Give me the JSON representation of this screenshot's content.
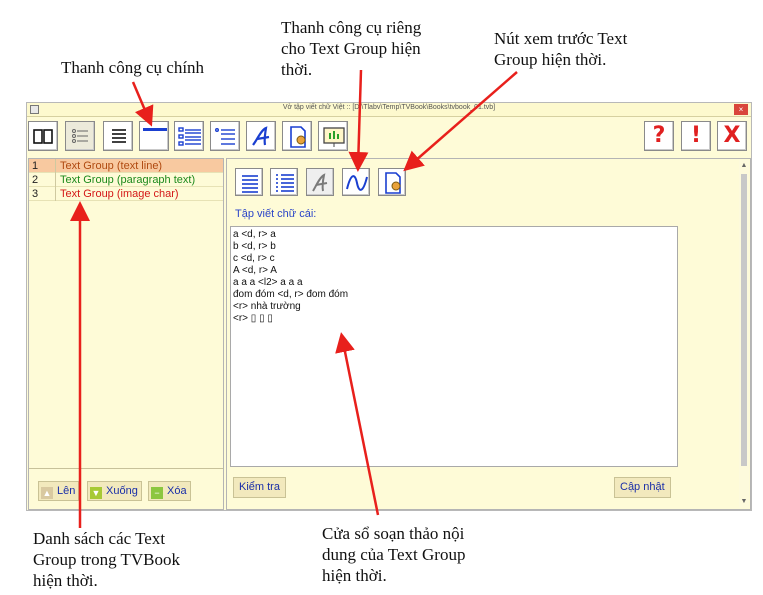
{
  "annotations": {
    "main_toolbar": "Thanh công cụ chính",
    "group_toolbar": [
      "Thanh công cụ riêng",
      "cho Text Group hiện",
      "thời."
    ],
    "preview_button": [
      "Nút xem trước Text",
      "Group hiện thời."
    ],
    "group_list": [
      "Danh sách các Text",
      "Group trong TVBook",
      "hiện thời."
    ],
    "editor": [
      "Cửa sổ soạn thảo nội",
      "dung của Text Group",
      "hiện thời."
    ]
  },
  "window": {
    "title": "Vở tập viết chữ Việt :: [D:\\Tlabv\\Temp\\TVBook\\Books\\tvbook_01.tvb]",
    "close_glyph": "×"
  },
  "toolbar": {
    "icons": [
      "two-pane-icon",
      "bullet-list-icon",
      "text-line-icon",
      "line-bar-icon",
      "paragraph-icon",
      "image-char-icon",
      "font-a-icon",
      "document-preview-icon",
      "presentation-icon"
    ],
    "help_label": "?",
    "info_label": "!",
    "exit_label": "X",
    "accent_red": "#e02020",
    "accent_blue": "#1a3fd0"
  },
  "groups": [
    {
      "num": "1",
      "name": "Text Group (text line)",
      "color": "#b04a10"
    },
    {
      "num": "2",
      "name": "Text Group (paragraph text)",
      "color": "#1c8a1c"
    },
    {
      "num": "3",
      "name": "Text Group (image char)",
      "color": "#d41818"
    }
  ],
  "list_buttons": {
    "up": "Lên",
    "down": "Xuống",
    "delete": "Xóa"
  },
  "group_toolbar": {
    "icons": [
      "text-lines-icon",
      "bullet-lines-icon",
      "font-a-icon",
      "wave-icon",
      "document-preview-icon"
    ]
  },
  "editor": {
    "label": "Tập viết chữ cái:",
    "lines": [
      "a <d, r> a",
      "b <d, r> b",
      "c <d, r> c",
      "A <d, r> A",
      "a a a <l2> a a a",
      "đom đóm <d, r> đom đóm",
      "<r> nhà trường",
      "<r> ▯ ▯ ▯"
    ]
  },
  "editor_buttons": {
    "check": "Kiểm tra",
    "update": "Cập nhật"
  }
}
